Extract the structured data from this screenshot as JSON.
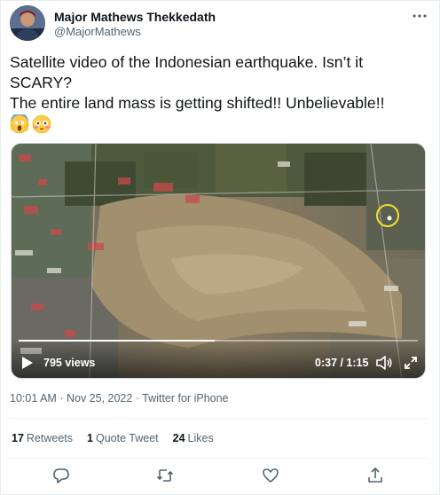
{
  "author": {
    "display_name": "Major Mathews Thekkedath",
    "handle": "@MajorMathews",
    "avatar_icon": "avatar-photo"
  },
  "tweet": {
    "lines": [
      "Satellite video of the Indonesian earthquake. Isn’t it",
      "SCARY?",
      "The entire land mass is getting shifted!! Unbelievable!!"
    ],
    "emojis": [
      "face-screaming-in-fear-emoji",
      "flushed-face-emoji"
    ]
  },
  "video": {
    "views": "795 views",
    "time": "0:37 / 1:15",
    "progress": 0.49
  },
  "meta": {
    "time": "10:01 AM",
    "sep1": "·",
    "date": "Nov 25, 2022",
    "sep2": "·",
    "source": "Twitter for iPhone"
  },
  "stats": {
    "retweets_count": "17",
    "retweets_label": "Retweets",
    "quotes_count": "1",
    "quotes_label": "Quote Tweet",
    "likes_count": "24",
    "likes_label": "Likes"
  },
  "actions": [
    "reply-icon",
    "retweet-icon",
    "like-icon",
    "share-icon"
  ],
  "colors": {
    "text": "#0f1419",
    "secondary": "#536471",
    "divider": "#eff3f4",
    "accent": "#1d9bf0"
  }
}
